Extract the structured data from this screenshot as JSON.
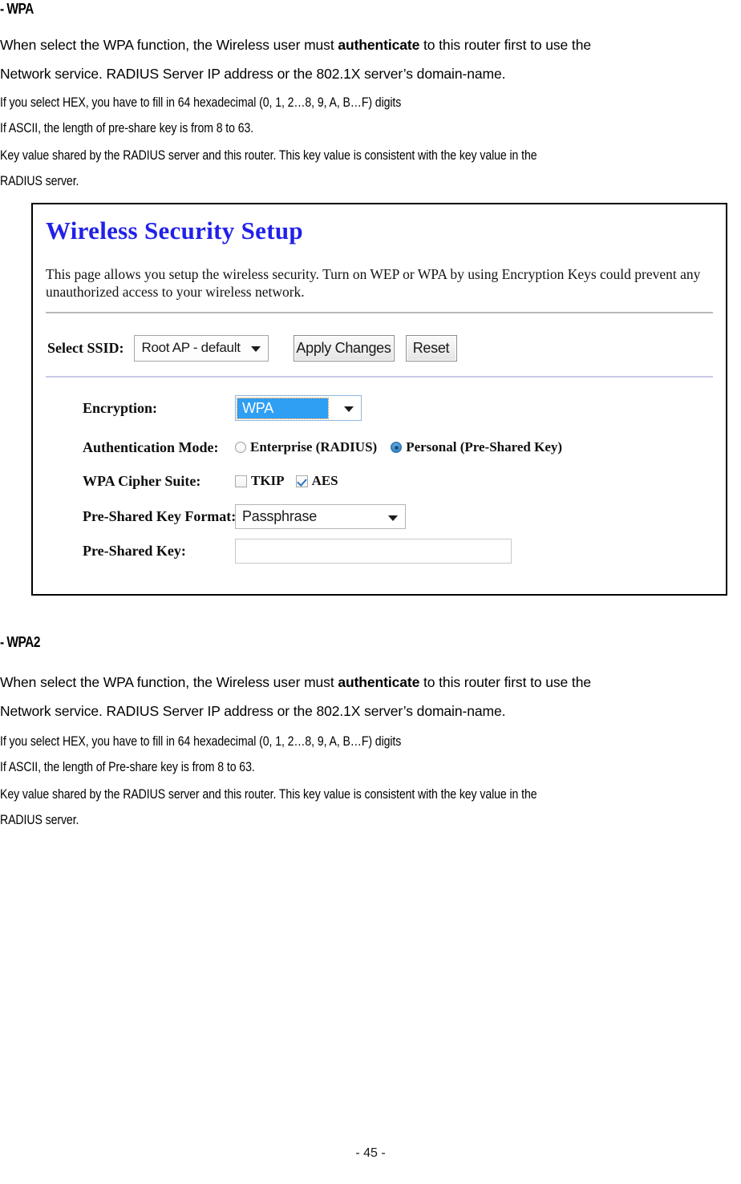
{
  "sections": [
    {
      "heading": "- WPA",
      "paragraphs_wide": [
        {
          "pre": "When select the WPA function, the Wireless user must ",
          "bold": "authenticate",
          "post": " to this router first to use the"
        },
        {
          "pre": "Network service. RADIUS Server IP address or the 802.1X server’s domain-name.",
          "bold": "",
          "post": ""
        }
      ],
      "paragraphs_narrow": [
        "If you select HEX, you have to fill in 64 hexadecimal (0, 1, 2…8, 9, A, B…F) digits",
        "If ASCII, the length of pre-share key is from 8 to 63.",
        "Key value shared by the RADIUS server and this router. This key value is consistent with the key value in the",
        "RADIUS server."
      ]
    },
    {
      "heading": "- WPA2",
      "paragraphs_wide": [
        {
          "pre": "When select the WPA function, the Wireless user must ",
          "bold": "authenticate",
          "post": " to this router first to use the"
        },
        {
          "pre": "Network service. RADIUS Server IP address or the 802.1X server’s domain-name.",
          "bold": "",
          "post": ""
        }
      ],
      "paragraphs_narrow": [
        "If you select HEX, you have to fill in 64 hexadecimal (0, 1, 2…8, 9, A, B…F) digits",
        "If ASCII, the length of Pre-share key is from 8 to 63.",
        "Key value shared by the RADIUS server and this router. This key value is consistent with the key value in the",
        "RADIUS server."
      ]
    }
  ],
  "screenshot": {
    "title": "Wireless Security Setup",
    "title_color": "#2121e8",
    "description": "This page allows you setup the wireless security. Turn on WEP or WPA by using Encryption Keys could prevent any unauthorized access to your wireless network.",
    "ssid_row": {
      "label": "Select SSID:",
      "select_value": "Root AP - default",
      "apply_label": "Apply Changes",
      "reset_label": "Reset"
    },
    "form": {
      "encryption": {
        "label": "Encryption:",
        "value": "WPA",
        "highlight_color": "#2f9ff3"
      },
      "auth_mode": {
        "label": "Authentication Mode:",
        "options": [
          {
            "text": "Enterprise (RADIUS)",
            "selected": false
          },
          {
            "text": "Personal (Pre-Shared Key)",
            "selected": true
          }
        ]
      },
      "cipher_suite": {
        "label": "WPA Cipher Suite:",
        "options": [
          {
            "text": "TKIP",
            "checked": false
          },
          {
            "text": "AES",
            "checked": true
          }
        ]
      },
      "psk_format": {
        "label": "Pre-Shared Key Format:",
        "value": "Passphrase"
      },
      "psk": {
        "label": "Pre-Shared Key:",
        "value": ""
      }
    }
  },
  "footer": {
    "page_number": "- 45 -"
  }
}
